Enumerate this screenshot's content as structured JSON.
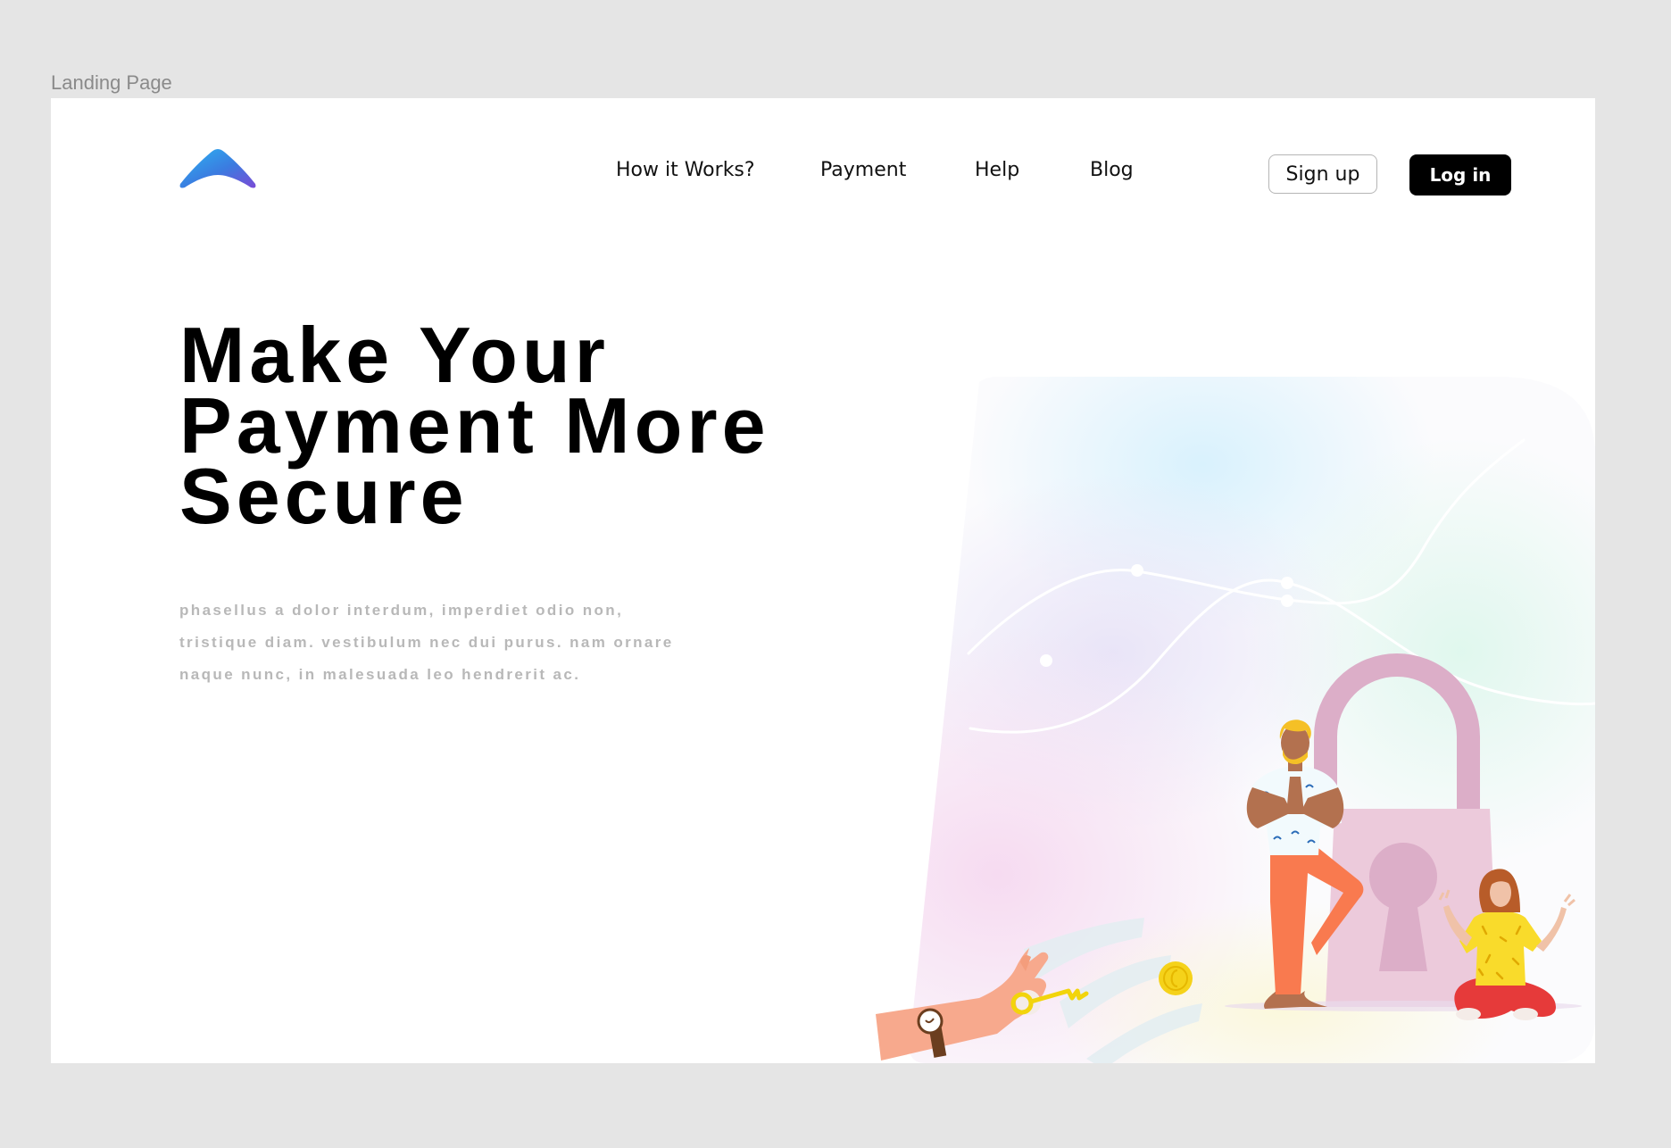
{
  "canvas": {
    "frame_label": "Landing Page"
  },
  "logo": {
    "icon": "chevron-up-logo-icon",
    "gradient": [
      "#2bb5f2",
      "#7a4bd6"
    ]
  },
  "nav": {
    "items": [
      {
        "label": "How it Works?"
      },
      {
        "label": "Payment"
      },
      {
        "label": "Help"
      },
      {
        "label": "Blog"
      }
    ],
    "signup_label": "Sign up",
    "login_label": "Log in"
  },
  "hero": {
    "title_lines": [
      "Make Your",
      "Payment More",
      "Secure"
    ],
    "description_lines": [
      "phasellus a dolor interdum, imperdiet odio non,",
      "tristique diam. vestibulum nec dui purus. nam ornare",
      "naque nunc, in malesuada leo hendrerit ac."
    ]
  },
  "illustration": {
    "icons": [
      "padlock-icon",
      "hand-with-key-icon",
      "coin-icon",
      "man-figure-icon",
      "woman-figure-icon"
    ],
    "colors": {
      "padlock": "#eccadb",
      "padlock_shackle": "#dcaec8",
      "key": "#f2d40c",
      "coin": "#f5d21a",
      "pants_man": "#f97a4f",
      "shirt_woman": "#f9db2b",
      "pants_woman": "#e63a3a"
    }
  }
}
